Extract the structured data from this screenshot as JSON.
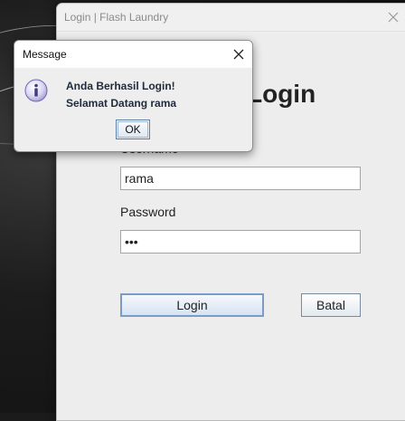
{
  "main_window": {
    "title": "Login | Flash Laundry",
    "heading": "Login",
    "username_label": "Username",
    "username_value": "rama",
    "password_label": "Password",
    "password_value": "•••",
    "login_button": "Login",
    "cancel_button": "Batal"
  },
  "message_dialog": {
    "title": "Message",
    "line1": "Anda Berhasil Login!",
    "line2": "Selamat Datang rama",
    "ok_button": "OK",
    "icon": "info-icon"
  },
  "icons": {
    "close": "close-icon",
    "info": "info-icon"
  }
}
